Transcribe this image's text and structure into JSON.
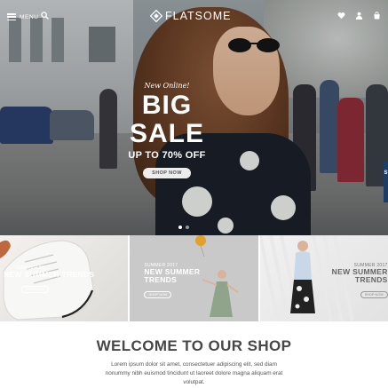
{
  "header": {
    "menu_label": "MENU",
    "logo_text": "FLATSOME",
    "icons": [
      "menu-icon",
      "search-icon",
      "heart-icon",
      "user-icon",
      "cart-icon"
    ]
  },
  "hero": {
    "kicker": "New Online!",
    "title": "BIG SALE",
    "subtitle": "UP TO 70% OFF",
    "button_label": "SHOP NOW",
    "next_slide_teaser": "S",
    "slides_count": 2,
    "active_slide": 1
  },
  "banners": [
    {
      "kicker": "SUMMER 2017",
      "title": "NEW SUMMER TRENDS",
      "button_label": "SHOP NOW"
    },
    {
      "kicker": "SUMMER 2017",
      "title": "NEW SUMMER TRENDS",
      "button_label": "SHOP NOW"
    },
    {
      "kicker": "SUMMER 2017",
      "title": "NEW SUMMER TRENDS",
      "button_label": "SHOP NOW"
    }
  ],
  "welcome": {
    "title": "WELCOME TO OUR SHOP",
    "body": "Lorem ipsum dolor sit amet, consectetuer adipiscing elit, sed diam nonummy nibh euismod tincidunt ut laoreet dolore magna aliquam erat volutpat."
  },
  "colors": {
    "text_dark": "#474747",
    "accent_strip": "#1d3d66",
    "white": "#ffffff"
  }
}
